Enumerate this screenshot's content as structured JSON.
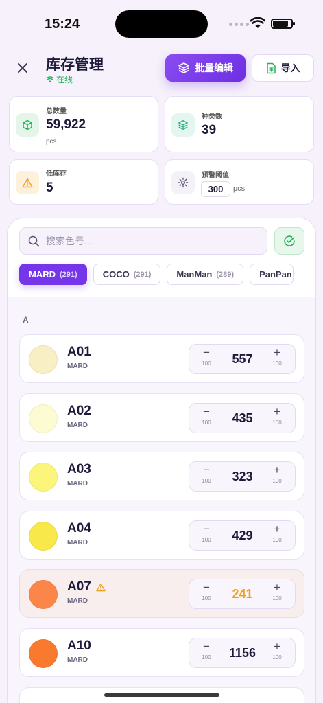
{
  "status": {
    "time": "15:24"
  },
  "header": {
    "title": "库存管理",
    "online": "在线",
    "batch_edit": "批量编辑",
    "import": "导入"
  },
  "stats": {
    "total": {
      "label": "总数量",
      "value": "59,922",
      "unit": "pcs"
    },
    "types": {
      "label": "种类数",
      "value": "39"
    },
    "low": {
      "label": "低库存",
      "value": "5"
    },
    "threshold": {
      "label": "预警阈值",
      "value": "300",
      "unit": "pcs"
    }
  },
  "search": {
    "placeholder": "搜索色号..."
  },
  "tabs": [
    {
      "label": "MARD",
      "count": "(291)"
    },
    {
      "label": "COCO",
      "count": "(291)"
    },
    {
      "label": "ManMan",
      "count": "(289)"
    },
    {
      "label": "PanPan",
      "count": ""
    }
  ],
  "section": "A",
  "rows": [
    {
      "code": "A01",
      "brand": "MARD",
      "qty": "557",
      "step": "100",
      "color": "#f9efc4"
    },
    {
      "code": "A02",
      "brand": "MARD",
      "qty": "435",
      "step": "100",
      "color": "#fdfbd2"
    },
    {
      "code": "A03",
      "brand": "MARD",
      "qty": "323",
      "step": "100",
      "color": "#fbf67b"
    },
    {
      "code": "A04",
      "brand": "MARD",
      "qty": "429",
      "step": "100",
      "color": "#f8e84a"
    },
    {
      "code": "A07",
      "brand": "MARD",
      "qty": "241",
      "step": "100",
      "color": "#fc8649",
      "warning": true
    },
    {
      "code": "A10",
      "brand": "MARD",
      "qty": "1156",
      "step": "100",
      "color": "#f9792f"
    }
  ],
  "colors": {
    "accent": "#7436e8",
    "online": "#22b45a",
    "warning": "#f0a020"
  }
}
